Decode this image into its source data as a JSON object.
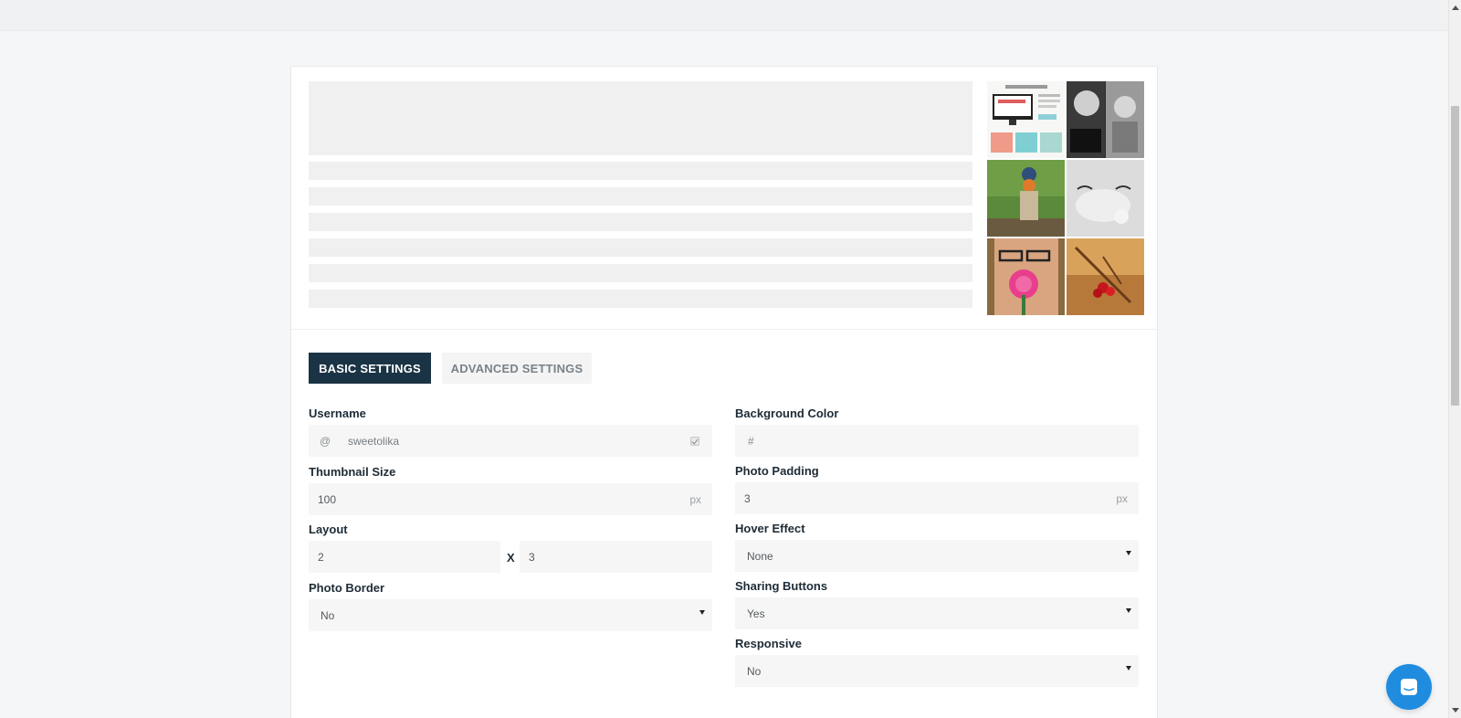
{
  "tabs": {
    "basic": "BASIC SETTINGS",
    "advanced": "ADVANCED SETTINGS"
  },
  "left": {
    "username": {
      "label": "Username",
      "prefix": "@",
      "value": "sweetolika"
    },
    "thumbnail_size": {
      "label": "Thumbnail Size",
      "value": "100",
      "suffix": "px"
    },
    "layout": {
      "label": "Layout",
      "cols": "2",
      "separator": "X",
      "rows": "3"
    },
    "photo_border": {
      "label": "Photo Border",
      "value": "No"
    }
  },
  "right": {
    "background_color": {
      "label": "Background Color",
      "placeholder": "#"
    },
    "photo_padding": {
      "label": "Photo Padding",
      "value": "3",
      "suffix": "px"
    },
    "hover_effect": {
      "label": "Hover Effect",
      "value": "None"
    },
    "sharing_buttons": {
      "label": "Sharing Buttons",
      "value": "Yes"
    },
    "responsive": {
      "label": "Responsive",
      "value": "No"
    }
  },
  "colors": {
    "active_tab": "#1b3445",
    "chat_button": "#1f8ce0",
    "field_bg": "#f6f6f6"
  },
  "icons": [
    "check-icon",
    "chat-icon"
  ]
}
